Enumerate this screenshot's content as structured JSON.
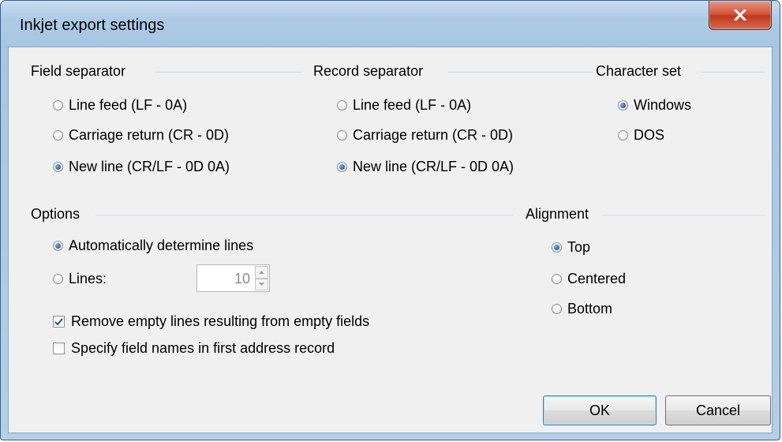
{
  "window": {
    "title": "Inkjet export settings"
  },
  "field_separator": {
    "label": "Field separator",
    "options": [
      "Line feed (LF - 0A)",
      "Carriage return (CR - 0D)",
      "New line (CR/LF - 0D 0A)"
    ],
    "selected": "New line (CR/LF - 0D 0A)"
  },
  "record_separator": {
    "label": "Record separator",
    "options": [
      "Line feed (LF - 0A)",
      "Carriage return (CR - 0D)",
      "New line (CR/LF - 0D 0A)"
    ],
    "selected": "New line (CR/LF - 0D 0A)"
  },
  "character_set": {
    "label": "Character set",
    "options": [
      "Windows",
      "DOS"
    ],
    "selected": "Windows"
  },
  "options": {
    "label": "Options",
    "auto_lines": "Automatically determine lines",
    "lines": "Lines:",
    "lines_value": "10",
    "remove_empty": "Remove empty lines resulting from empty fields",
    "remove_empty_checked": true,
    "field_names": "Specify field names in first address record",
    "field_names_checked": false
  },
  "alignment": {
    "label": "Alignment",
    "options": [
      "Top",
      "Centered",
      "Bottom"
    ],
    "selected": "Top"
  },
  "buttons": {
    "ok": "OK",
    "cancel": "Cancel"
  }
}
